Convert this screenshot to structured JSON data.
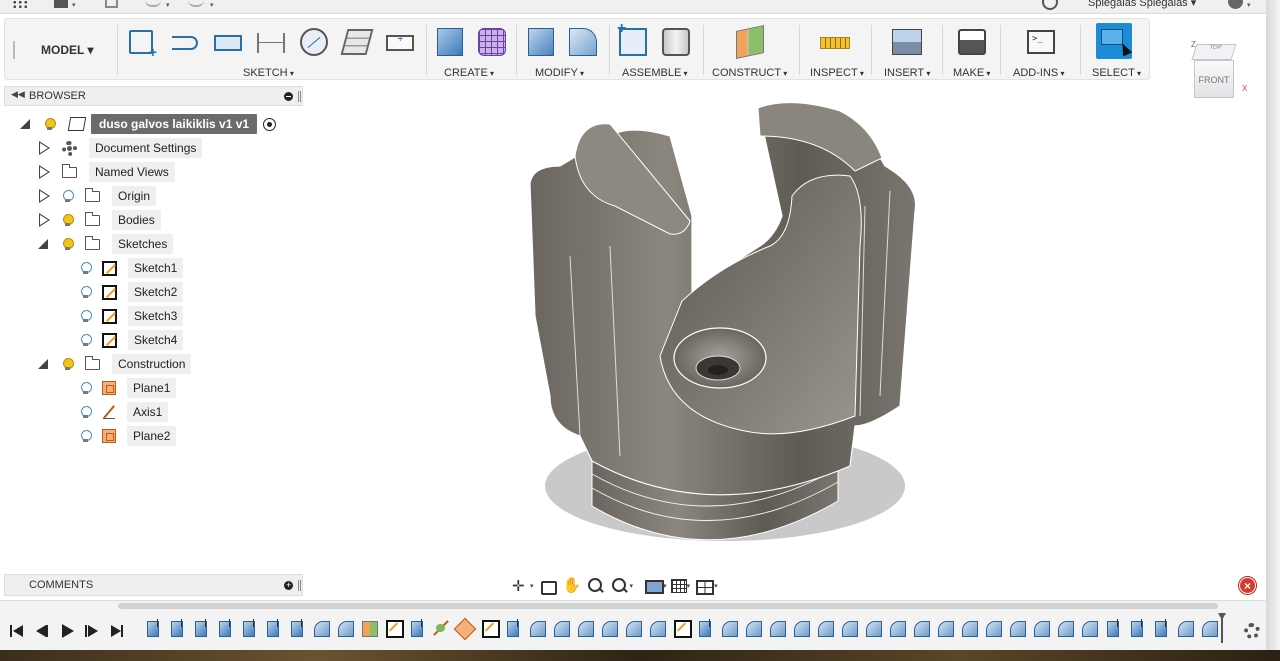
{
  "app": {
    "user_name": "Spiegalas Spiegalas"
  },
  "toolbar": {
    "workspace": "MODEL",
    "groups": {
      "sketch": "SKETCH",
      "create": "CREATE",
      "modify": "MODIFY",
      "assemble": "ASSEMBLE",
      "construct": "CONSTRUCT",
      "inspect": "INSPECT",
      "insert": "INSERT",
      "make": "MAKE",
      "addins": "ADD-INS",
      "select": "SELECT"
    }
  },
  "viewcube": {
    "top": "TOP",
    "front": "FRONT",
    "axis_z": "Z",
    "axis_x": "X"
  },
  "browser": {
    "title": "BROWSER",
    "root": "duso galvos laikiklis v1 v1",
    "items": [
      {
        "label": "Document Settings"
      },
      {
        "label": "Named Views"
      },
      {
        "label": "Origin"
      },
      {
        "label": "Bodies"
      },
      {
        "label": "Sketches"
      },
      {
        "label": "Sketch1"
      },
      {
        "label": "Sketch2"
      },
      {
        "label": "Sketch3"
      },
      {
        "label": "Sketch4"
      },
      {
        "label": "Construction"
      },
      {
        "label": "Plane1"
      },
      {
        "label": "Axis1"
      },
      {
        "label": "Plane2"
      }
    ]
  },
  "comments": {
    "title": "COMMENTS"
  },
  "close_glyph": "×",
  "timeline": {
    "features": [
      "extrude",
      "extrude",
      "extrude",
      "extrude",
      "extrude",
      "extrude",
      "extrude",
      "fillet",
      "fillet",
      "plane",
      "sketch",
      "extrude",
      "axis",
      "hole",
      "sketch",
      "extrude",
      "fillet",
      "fillet",
      "fillet",
      "fillet",
      "fillet",
      "fillet",
      "sketch",
      "extrude",
      "fillet",
      "fillet",
      "fillet",
      "fillet",
      "fillet",
      "fillet",
      "fillet",
      "fillet",
      "fillet",
      "fillet",
      "fillet",
      "fillet",
      "fillet",
      "fillet",
      "fillet",
      "fillet",
      "extrude",
      "extrude",
      "extrude",
      "fillet",
      "fillet"
    ]
  },
  "colors": {
    "select_accent": "#1e8bd6",
    "root_node_bg": "#6b6b6b",
    "close_button": "#d63a2e",
    "model_body": "#6e6a63"
  }
}
